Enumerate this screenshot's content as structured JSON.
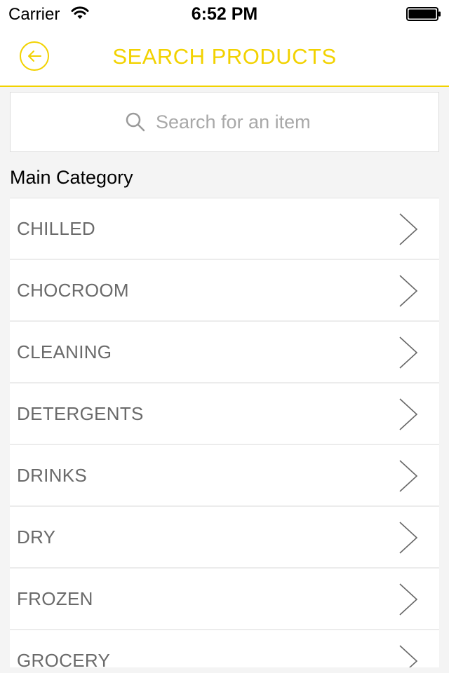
{
  "status_bar": {
    "carrier": "Carrier",
    "time": "6:52 PM"
  },
  "header": {
    "title": "SEARCH PRODUCTS",
    "back_icon": "arrow-left-circle-icon"
  },
  "search": {
    "placeholder": "Search for an item",
    "icon": "search-icon"
  },
  "section": {
    "label": "Main Category"
  },
  "categories": [
    "CHILLED",
    "CHOCROOM",
    "CLEANING",
    "DETERGENTS",
    "DRINKS",
    "DRY",
    "FROZEN",
    "GROCERY"
  ],
  "colors": {
    "accent": "#f2d200",
    "item_text": "#6a6a6a",
    "background": "#f4f4f4"
  }
}
